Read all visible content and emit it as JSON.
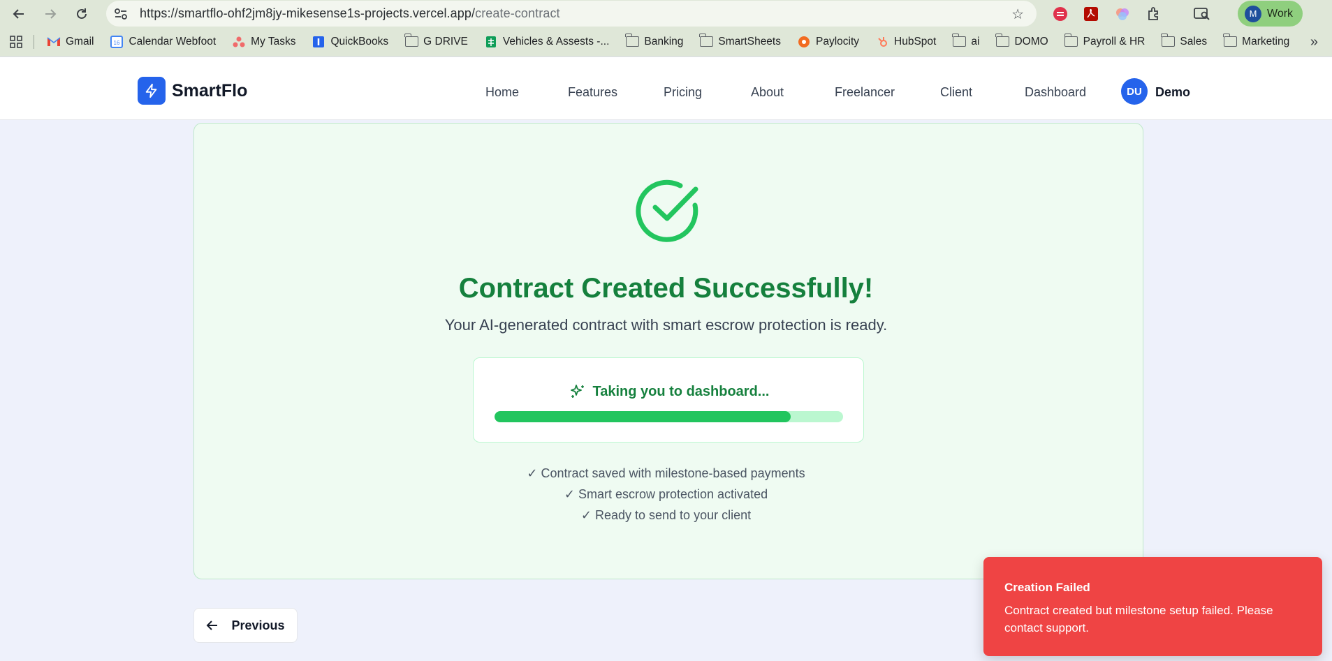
{
  "browser": {
    "url_host": "https://smartflo-ohf2jm8jy-mikesense1s-projects.vercel.app/",
    "url_path": "create-contract",
    "profile_initial": "M",
    "profile_label": "Work",
    "bookmarks": [
      {
        "label": "Gmail",
        "icon": "gmail-icon"
      },
      {
        "label": "Calendar Webfoot",
        "icon": "calendar-icon"
      },
      {
        "label": "My Tasks",
        "icon": "asana-icon"
      },
      {
        "label": "QuickBooks",
        "icon": "quickbooks-icon"
      },
      {
        "label": "G DRIVE",
        "icon": "folder-icon"
      },
      {
        "label": "Vehicles & Assests -...",
        "icon": "sheets-icon"
      },
      {
        "label": "Banking",
        "icon": "folder-icon"
      },
      {
        "label": "SmartSheets",
        "icon": "folder-icon"
      },
      {
        "label": "Paylocity",
        "icon": "paylocity-icon"
      },
      {
        "label": "HubSpot",
        "icon": "hubspot-icon"
      },
      {
        "label": "ai",
        "icon": "folder-icon"
      },
      {
        "label": "DOMO",
        "icon": "folder-icon"
      },
      {
        "label": "Payroll & HR",
        "icon": "folder-icon"
      },
      {
        "label": "Sales",
        "icon": "folder-icon"
      },
      {
        "label": "Marketing",
        "icon": "folder-icon"
      }
    ]
  },
  "app": {
    "brand": "SmartFlo",
    "nav": [
      "Home",
      "Features",
      "Pricing",
      "About",
      "Freelancer",
      "Client",
      "Dashboard"
    ],
    "user_initials": "DU",
    "user_name": "Demo"
  },
  "success": {
    "title": "Contract Created Successfully!",
    "subtitle": "Your AI-generated contract with smart escrow protection is ready.",
    "progress_label": "Taking you to dashboard...",
    "progress_fraction": 0.85,
    "checklist": [
      "✓ Contract saved with milestone-based payments",
      "✓ Smart escrow protection activated",
      "✓ Ready to send to your client"
    ]
  },
  "footer": {
    "previous_label": "Previous"
  },
  "toast": {
    "title": "Creation Failed",
    "message": "Contract created but milestone setup failed. Please contact support."
  },
  "colors": {
    "primary": "#2563eb",
    "success": "#15803d",
    "toast_error": "#ef4444"
  }
}
